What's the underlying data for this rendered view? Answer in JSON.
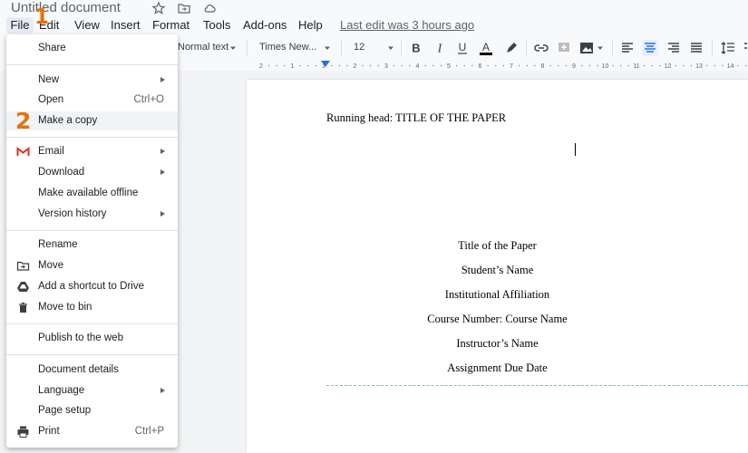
{
  "document": {
    "title": "Untitled document",
    "last_edit": "Last edit was 3 hours ago"
  },
  "menubar": {
    "items": [
      "File",
      "Edit",
      "View",
      "Insert",
      "Format",
      "Tools",
      "Add-ons",
      "Help"
    ]
  },
  "annotations": {
    "step1": "1",
    "step2": "2"
  },
  "toolbar": {
    "style": "Normal text",
    "font": "Times New...",
    "font_size": "12"
  },
  "ruler": {
    "ticks": [
      "2",
      "1",
      "1",
      "2",
      "3",
      "4",
      "5",
      "6",
      "7",
      "8",
      "9",
      "10",
      "11",
      "12",
      "13",
      "14"
    ]
  },
  "file_menu": {
    "share": "Share",
    "new": "New",
    "open": "Open",
    "open_shortcut": "Ctrl+O",
    "make_copy": "Make a copy",
    "email": "Email",
    "download": "Download",
    "offline": "Make available offline",
    "version_history": "Version history",
    "rename": "Rename",
    "move": "Move",
    "add_shortcut": "Add a shortcut to Drive",
    "move_to_bin": "Move to bin",
    "publish": "Publish to the web",
    "details": "Document details",
    "language": "Language",
    "page_setup": "Page setup",
    "print": "Print",
    "print_shortcut": "Ctrl+P"
  },
  "page": {
    "running_head": "Running head: TITLE OF THE PAPER",
    "title": "Title of the Paper",
    "student": "Student’s Name",
    "affiliation": "Institutional Affiliation",
    "course": "Course Number: Course Name",
    "instructor": "Instructor’s Name",
    "due_date": "Assignment Due Date"
  },
  "colors": {
    "accent": "#1a73e8",
    "annotation": "#e8710a",
    "gmail_red": "#d93025"
  }
}
